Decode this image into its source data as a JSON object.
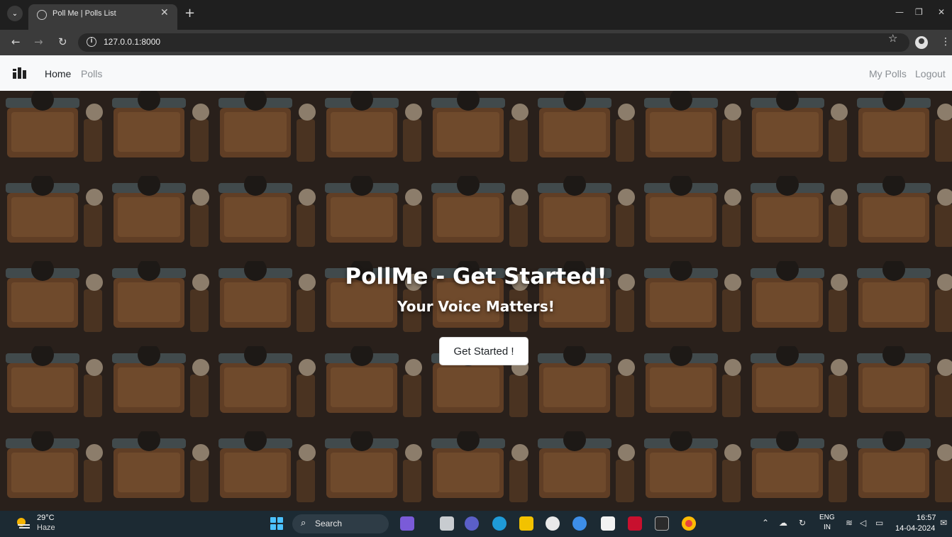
{
  "browser": {
    "tab_title": "Poll Me | Polls List",
    "url": "127.0.0.1:8000"
  },
  "site": {
    "nav_left": [
      "Home",
      "Polls"
    ],
    "nav_right": [
      "My Polls",
      "Logout"
    ]
  },
  "hero": {
    "title": "PollMe - Get Started!",
    "subtitle": "Your Voice Matters!",
    "cta_label": "Get Started !"
  },
  "taskbar": {
    "weather_temp": "29°C",
    "weather_cond": "Haze",
    "search_label": "Search",
    "lang_top": "ENG",
    "lang_bottom": "IN",
    "time": "16:57",
    "date": "14-04-2024"
  }
}
